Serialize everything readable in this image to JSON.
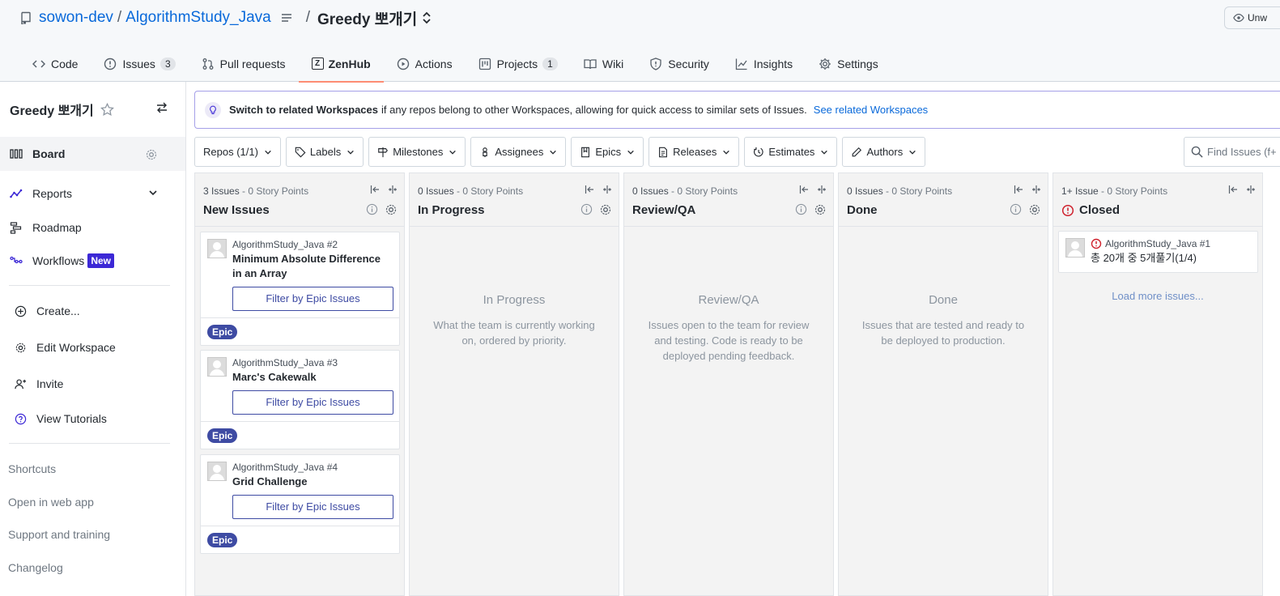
{
  "header": {
    "owner": "sowon-dev",
    "separator": "/",
    "repo": "AlgorithmStudy_Java",
    "separator2": "/",
    "workspace": "Greedy 뽀개기",
    "unwatch_label": "Unw"
  },
  "tabs": [
    {
      "label": "Code",
      "icon": "code-icon"
    },
    {
      "label": "Issues",
      "icon": "issue-icon",
      "count": "3"
    },
    {
      "label": "Pull requests",
      "icon": "pull-request-icon"
    },
    {
      "label": "ZenHub",
      "icon": "zenhub-icon",
      "active": true
    },
    {
      "label": "Actions",
      "icon": "play-icon"
    },
    {
      "label": "Projects",
      "icon": "project-icon",
      "count": "1"
    },
    {
      "label": "Wiki",
      "icon": "book-icon"
    },
    {
      "label": "Security",
      "icon": "shield-icon"
    },
    {
      "label": "Insights",
      "icon": "graph-icon"
    },
    {
      "label": "Settings",
      "icon": "gear-icon"
    }
  ],
  "sidebar": {
    "workspace_title": "Greedy 뽀개기",
    "nav": {
      "board": "Board",
      "reports": "Reports",
      "roadmap": "Roadmap",
      "workflows": "Workflows",
      "workflows_badge": "New"
    },
    "actions": {
      "create": "Create...",
      "edit": "Edit Workspace",
      "invite": "Invite",
      "tutorials": "View Tutorials"
    },
    "links": {
      "shortcuts": "Shortcuts",
      "web_app": "Open in web app",
      "support": "Support and training",
      "changelog": "Changelog"
    }
  },
  "banner": {
    "bold": "Switch to related Workspaces",
    "text": "if any repos belong to other Workspaces, allowing for quick access to similar sets of Issues.",
    "link": "See related Workspaces"
  },
  "filters": {
    "repos": "Repos (1/1)",
    "labels": "Labels",
    "milestones": "Milestones",
    "assignees": "Assignees",
    "epics": "Epics",
    "releases": "Releases",
    "estimates": "Estimates",
    "authors": "Authors",
    "search_placeholder": "Find Issues (f+"
  },
  "columns": [
    {
      "count": "3 Issues",
      "points": " - 0 Story Points",
      "name": "New Issues",
      "cards": [
        {
          "repo": "AlgorithmStudy_Java #2",
          "title": "Minimum Absolute Difference in an Array",
          "button": "Filter by Epic Issues",
          "badge": "Epic"
        },
        {
          "repo": "AlgorithmStudy_Java #3",
          "title": "Marc's Cakewalk",
          "button": "Filter by Epic Issues",
          "badge": "Epic"
        },
        {
          "repo": "AlgorithmStudy_Java #4",
          "title": "Grid Challenge",
          "button": "Filter by Epic Issues",
          "badge": "Epic"
        }
      ]
    },
    {
      "count": "0 Issues",
      "points": " - 0 Story Points",
      "name": "In Progress",
      "empty_title": "In Progress",
      "empty_desc": "What the team is currently working on, ordered by priority."
    },
    {
      "count": "0 Issues",
      "points": " - 0 Story Points",
      "name": "Review/QA",
      "empty_title": "Review/QA",
      "empty_desc": "Issues open to the team for review and testing. Code is ready to be deployed pending feedback."
    },
    {
      "count": "0 Issues",
      "points": " - 0 Story Points",
      "name": "Done",
      "empty_title": "Done",
      "empty_desc": "Issues that are tested and ready to be deployed to production."
    },
    {
      "count": "1+ Issue",
      "points": " - 0 Story Points",
      "name": "Closed",
      "cards": [
        {
          "repo": "AlgorithmStudy_Java #1",
          "title": "총 20개 중 5개풀기(1/4)"
        }
      ],
      "load_more": "Load more issues..."
    }
  ],
  "colors": {
    "link": "#0969da",
    "epic": "#3e4ba3",
    "new_badge": "#3c28d6",
    "active_tab_underline": "#fd8c73",
    "closed_icon": "#cf222e"
  }
}
